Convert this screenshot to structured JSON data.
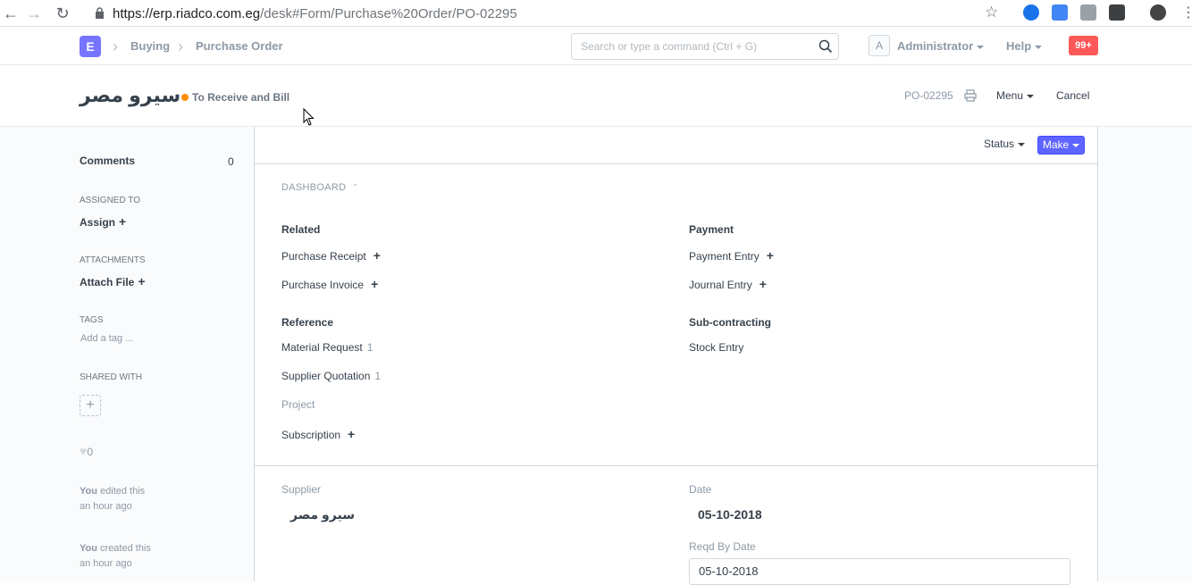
{
  "browser": {
    "url_host": "https://erp.riadco.com.eg",
    "url_path": "/desk#Form/Purchase%20Order/PO-02295"
  },
  "navbar": {
    "logo_letter": "E",
    "breadcrumbs": [
      "Buying",
      "Purchase Order"
    ],
    "search_placeholder": "Search or type a command (Ctrl + G)",
    "avatar_letter": "A",
    "user": "Administrator",
    "help": "Help",
    "notifications": "99+"
  },
  "page": {
    "title": "سيرو مصر",
    "status": "To Receive and Bill",
    "status_color": "#ff8f00",
    "doc_name": "PO-02295",
    "menu": "Menu",
    "cancel": "Cancel"
  },
  "sidebar": {
    "comments_label": "Comments",
    "comments_count": "0",
    "assigned_to_label": "ASSIGNED TO",
    "assign": "Assign",
    "attachments_label": "ATTACHMENTS",
    "attach_file": "Attach File",
    "tags_label": "TAGS",
    "add_tag": "Add a tag ...",
    "shared_with_label": "SHARED WITH",
    "likes": "0",
    "timeline": [
      {
        "who": "You",
        "action": "edited this",
        "when": "an hour ago"
      },
      {
        "who": "You",
        "action": "created this",
        "when": "an hour ago"
      }
    ]
  },
  "toolbar": {
    "status": "Status",
    "make": "Make",
    "accent_color": "#5e64ff"
  },
  "dashboard": {
    "heading": "DASHBOARD",
    "related": {
      "heading": "Related",
      "items": [
        {
          "label": "Purchase Receipt"
        },
        {
          "label": "Purchase Invoice"
        }
      ]
    },
    "payment": {
      "heading": "Payment",
      "items": [
        {
          "label": "Payment Entry"
        },
        {
          "label": "Journal Entry"
        }
      ]
    },
    "reference": {
      "heading": "Reference",
      "items": [
        {
          "label": "Material Request",
          "count": "1"
        },
        {
          "label": "Supplier Quotation",
          "count": "1"
        },
        {
          "label": "Project"
        },
        {
          "label": "Subscription"
        }
      ]
    },
    "subcontracting": {
      "heading": "Sub-contracting",
      "items": [
        {
          "label": "Stock Entry"
        }
      ]
    }
  },
  "form": {
    "supplier_label": "Supplier",
    "supplier_value": "سيرو مصر",
    "date_label": "Date",
    "date_value": "05-10-2018",
    "reqd_by_label": "Reqd By Date",
    "reqd_by_value": "05-10-2018"
  }
}
